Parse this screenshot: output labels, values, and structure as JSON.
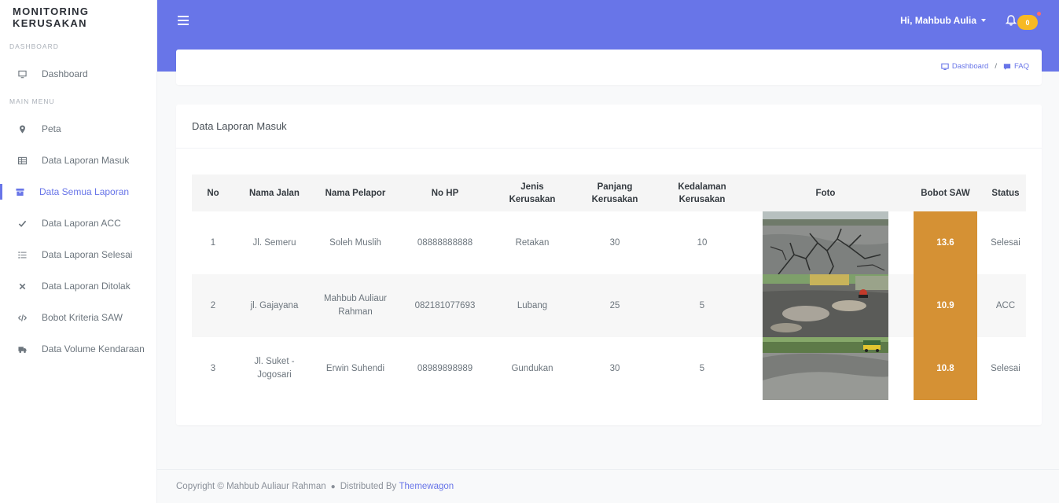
{
  "brand": "MONITORING KERUSAKAN",
  "sidebar": {
    "dashboard_heading": "DASHBOARD",
    "main_heading": "MAIN MENU",
    "items": [
      {
        "label": "Dashboard",
        "icon": "monitor-icon"
      },
      {
        "label": "Peta",
        "icon": "map-pin-icon"
      },
      {
        "label": "Data Laporan Masuk",
        "icon": "table-icon"
      },
      {
        "label": "Data Semua Laporan",
        "icon": "archive-icon",
        "active": true
      },
      {
        "label": "Data Laporan ACC",
        "icon": "check-icon"
      },
      {
        "label": "Data Laporan Selesai",
        "icon": "list-icon"
      },
      {
        "label": "Data Laporan Ditolak",
        "icon": "close-icon"
      },
      {
        "label": "Bobot Kriteria SAW",
        "icon": "code-icon"
      },
      {
        "label": "Data Volume Kendaraan",
        "icon": "truck-icon"
      }
    ]
  },
  "topbar": {
    "user_greeting": "Hi, Mahbub Aulia",
    "notification_count": "0"
  },
  "breadcrumb": {
    "home": "Dashboard",
    "current": "FAQ"
  },
  "card": {
    "title": "Data Laporan Masuk"
  },
  "table": {
    "headers": {
      "no": "No",
      "nama_jalan": "Nama Jalan",
      "nama_pelapor": "Nama Pelapor",
      "no_hp": "No HP",
      "jenis": "Jenis Kerusakan",
      "panjang": "Panjang Kerusakan",
      "kedalaman": "Kedalaman Kerusakan",
      "foto": "Foto",
      "bobot": "Bobot SAW",
      "status": "Status"
    },
    "rows": [
      {
        "no": "1",
        "nama_jalan": "Jl. Semeru",
        "nama_pelapor": "Soleh Muslih",
        "no_hp": "08888888888",
        "jenis": "Retakan",
        "panjang": "30",
        "kedalaman": "10",
        "bobot": "13.6",
        "status": "Selesai"
      },
      {
        "no": "2",
        "nama_jalan": "jl. Gajayana",
        "nama_pelapor": "Mahbub Auliaur Rahman",
        "no_hp": "082181077693",
        "jenis": "Lubang",
        "panjang": "25",
        "kedalaman": "5",
        "bobot": "10.9",
        "status": "ACC"
      },
      {
        "no": "3",
        "nama_jalan": "Jl. Suket - Jogosari",
        "nama_pelapor": "Erwin Suhendi",
        "no_hp": "08989898989",
        "jenis": "Gundukan",
        "panjang": "30",
        "kedalaman": "5",
        "bobot": "10.8",
        "status": "Selesai"
      }
    ]
  },
  "footer": {
    "copyright": "Copyright © Mahbub Auliaur Rahman",
    "distributed": "Distributed By",
    "link": "Themewagon"
  },
  "colors": {
    "primary": "#6875e8",
    "bobot": "#d59134",
    "badge": "#f7b924"
  }
}
